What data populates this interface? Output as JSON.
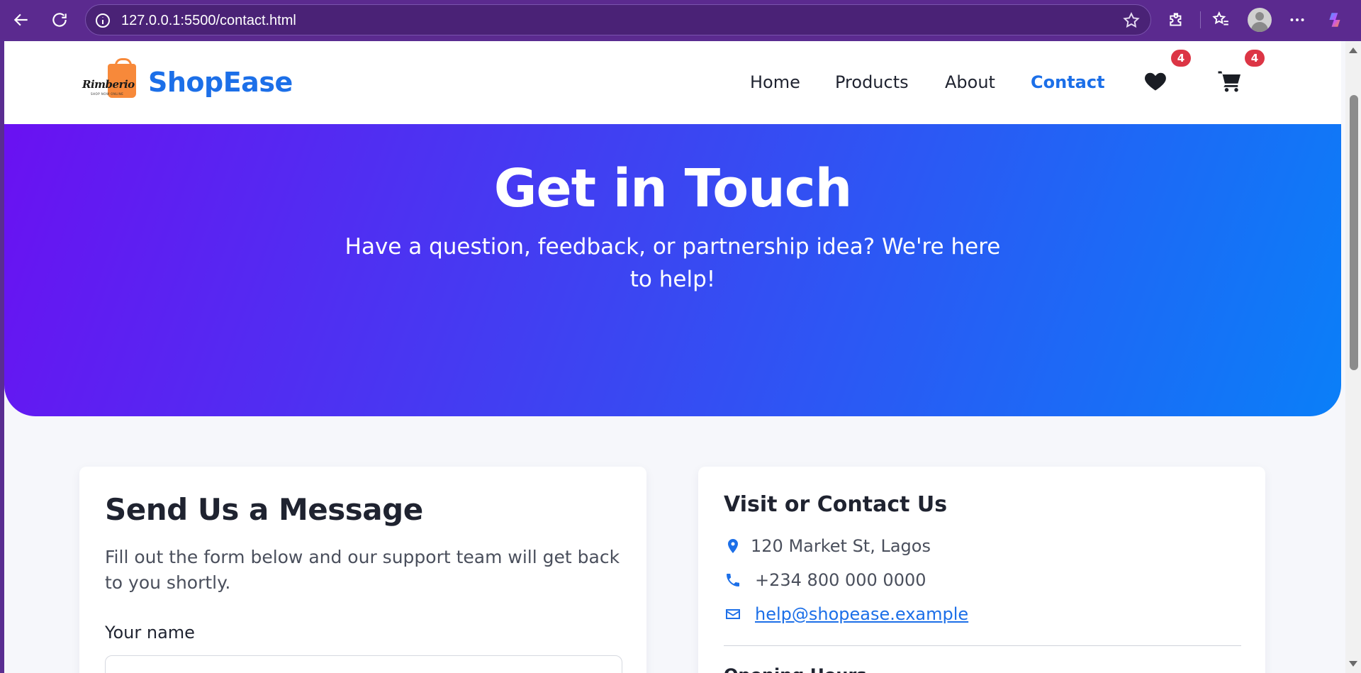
{
  "browser": {
    "url": "127.0.0.1:5500/contact.html"
  },
  "header": {
    "logo_text": "Rimberio",
    "logo_subtext": "SHOP NOW ONLINE",
    "brand": "ShopEase",
    "nav": [
      {
        "label": "Home",
        "active": false
      },
      {
        "label": "Products",
        "active": false
      },
      {
        "label": "About",
        "active": false
      },
      {
        "label": "Contact",
        "active": true
      }
    ],
    "wishlist_count": "4",
    "cart_count": "4"
  },
  "hero": {
    "title": "Get in Touch",
    "subtitle": "Have a question, feedback, or partnership idea? We're here to help!"
  },
  "form_card": {
    "title": "Send Us a Message",
    "description": "Fill out the form below and our support team will get back to you shortly.",
    "name_label": "Your name"
  },
  "contact_card": {
    "title": "Visit or Contact Us",
    "address": "120 Market St, Lagos",
    "phone": "+234 800 000 0000",
    "email": "help@shopease.example",
    "hours_title": "Opening Hours"
  },
  "colors": {
    "brand": "#1c6fe8",
    "hero_start": "#6a11f2",
    "hero_end": "#0a7ff8",
    "badge": "#dc3545",
    "browser_frame": "#5b2a8f"
  }
}
